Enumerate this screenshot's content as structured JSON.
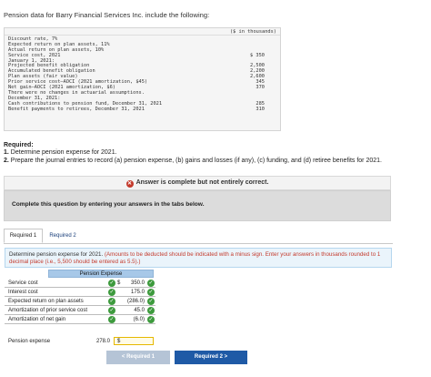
{
  "intro": "Pension data for Barry Financial Services Inc. include the following:",
  "data_header": "($ in thousands)",
  "data_lines": [
    {
      "label": "Discount rate, 7%",
      "value": ""
    },
    {
      "label": "Expected return on plan assets, 11%",
      "value": ""
    },
    {
      "label": "Actual return on plan assets, 10%",
      "value": ""
    },
    {
      "label": "Service cost, 2021",
      "value": "$ 350"
    },
    {
      "label": "January 1, 2021:",
      "value": ""
    },
    {
      "label": "Projected benefit obligation",
      "value": "2,500"
    },
    {
      "label": "Accumulated benefit obligation",
      "value": "2,200"
    },
    {
      "label": "Plan assets (fair value)",
      "value": "2,600"
    },
    {
      "label": "Prior service cost–AOCI (2021 amortization, $45)",
      "value": "345"
    },
    {
      "label": "Net gain–AOCI (2021 amortization, $6)",
      "value": "370"
    },
    {
      "label": "There were no changes in actuarial assumptions.",
      "value": ""
    },
    {
      "label": "December 31, 2021:",
      "value": ""
    },
    {
      "label": "Cash contributions to pension fund, December 31, 2021",
      "value": "285"
    },
    {
      "label": "Benefit payments to retirees, December 31, 2021",
      "value": "310"
    }
  ],
  "required_title": "Required:",
  "req1": "Determine pension expense for 2021.",
  "req2": "Prepare the journal entries to record (a) pension expense, (b) gains and losses (if any), (c) funding, and (d) retiree benefits for 2021.",
  "banner": "Answer is complete but not entirely correct.",
  "complete_text": "Complete this question by entering your answers in the tabs below.",
  "tabs": [
    "Required 1",
    "Required 2"
  ],
  "instr_main": "Determine pension expense for 2021.",
  "instr_red": "(Amounts to be deducted should be indicated with a minus sign. Enter your answers in thousands rounded to 1 decimal place (i.e., 5,500 should be entered as 5.5).)",
  "table_header": "Pension Expense",
  "rows": [
    {
      "label": "Service cost",
      "currency": "$",
      "value": "350.0"
    },
    {
      "label": "Interest cost",
      "currency": "",
      "value": "175.0"
    },
    {
      "label": "Expected return on plan assets",
      "currency": "",
      "value": "(286.0)"
    },
    {
      "label": "Amortization of prior service cost",
      "currency": "",
      "value": "45.0"
    },
    {
      "label": "Amortization of net gain",
      "currency": "",
      "value": "(6.0)"
    }
  ],
  "total": {
    "label": "Pension expense",
    "currency": "$",
    "value": "278.0"
  },
  "prev_button": "< Required 1",
  "next_button": "Required 2  >"
}
